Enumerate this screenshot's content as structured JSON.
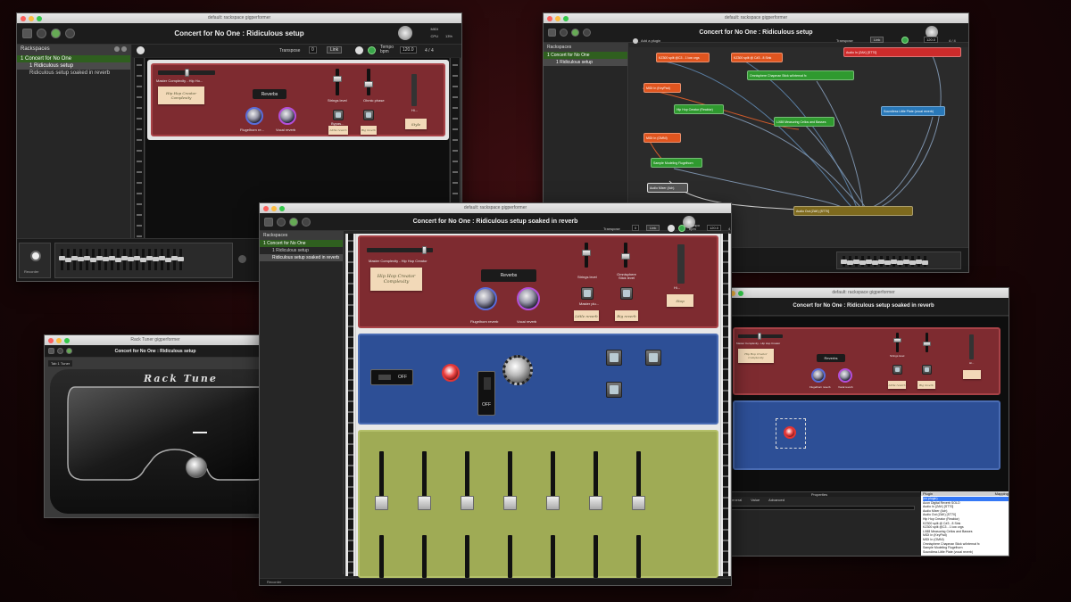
{
  "app_name": "gigperformer",
  "w1": {
    "mac_title": "default: rackspace gigperformer",
    "title": "Concert for No One : Ridiculous setup",
    "rackspaces_label": "Rackspaces",
    "items": [
      "1 Concert for No One",
      "1  Ridiculous setup",
      "Ridiculous setup soaked in reverb"
    ],
    "transpose_label": "Transpose",
    "transpose_value": "0",
    "link": "Link",
    "tempo_label": "Tempo bpm",
    "tempo": "120.0",
    "time": "4 / 4",
    "time_label": "Time",
    "cpu_label": "CPU",
    "cpu": "13%",
    "midi_label": "MIDI",
    "master": "Master Complexity - Hip Ho...",
    "note1": "Hip Hop Creator Complexity",
    "reverbs": "Reverbs",
    "k1": "Flugelhorn re...",
    "k2": "Vocal reverb",
    "strings": "Strings level",
    "ohmic": "Ohmic phase",
    "bypass": "Bypas...",
    "note_little": "Little reverb",
    "note_big": "Big reverb",
    "note_hh": "Hi...",
    "note_stp": "Style",
    "recorder": "Recorder"
  },
  "w2": {
    "mac_title": "default: rackspace gigperformer",
    "title": "Concert for No One : Ridiculous setup",
    "rackspaces_label": "Rackspaces",
    "items": [
      "1 Concert for No One",
      "1  Ridiculous setup"
    ],
    "add_plugin": "Add a plugin",
    "transpose_label": "Transpose",
    "link": "Link",
    "tempo": "120.0",
    "time": "4 / 4",
    "nodes": [
      "KZ300 split @C3 - 1 low orgs",
      "KZ300 split @ C#3 - 8 Sink",
      "Audio In (ZAK) [ST70]",
      "Omnisphere Chapman Stick w/Internal fx",
      "MIDI In (KeyPad)",
      "Hip Hop Creator (Reaktor)",
      "LX88 Measuring Cellos and Basses",
      "Soundless Little Plate (vocal reverb)",
      "MIDI In (OMNI)",
      "Sample Modeling Flugelhorn",
      "Audio Mixer (4ch)",
      "Audio Out (ZAK) [ST70]"
    ],
    "colors": {
      "orange": "#e0551f",
      "green": "#2f9a2f",
      "red": "#cc2b2b",
      "blue": "#2978b8",
      "olive": "#7e6a1e"
    }
  },
  "w3": {
    "mac_title": "Rack Tuner gigperformer",
    "title": "Concert for No One : Ridiculous setup",
    "tab": "Tab 1 Tuner",
    "logo": "Rack Tune"
  },
  "w4": {
    "mac_title": "default: rackspace gigperformer",
    "title": "Concert for No One : Ridiculous setup soaked in reverb",
    "rackspaces_label": "Rackspaces",
    "items": [
      "1 Concert for No One",
      "1  Ridiculous setup",
      "Ridiculous setup soaked in reverb"
    ],
    "transpose_label": "Transpose",
    "transpose_value": "0",
    "link": "Link",
    "tempo_label": "Tempo bpm",
    "tempo": "120.0",
    "time": "4 / 4",
    "master": "Master Complexity - Hip Hop Creator",
    "note1": "Hip Hop Creator Complexity",
    "reverbs": "Reverbs",
    "k1": "Flugelhorn reverb",
    "k2": "Vocal reverb",
    "strings": "Strings level",
    "ohmic": "Omnisphere Stick level",
    "bypass": "Master plu...",
    "note_little": "Little reverb",
    "note_big": "Big reverb",
    "note_hh": "Hi...",
    "note_stp": "Stop",
    "off1": "OFF",
    "off2": "OFF",
    "recorder": "Recorder"
  },
  "w5": {
    "mac_title": "default: rackspace gigperformer",
    "title": "Concert for No One : Ridiculous setup soaked in reverb",
    "reverbs": "Reverbs",
    "note1": "Hip Hop Creator Complexity",
    "master": "Master Complexity - Hip Hop Creator",
    "k1": "Flugelhorn reverb",
    "k2": "Vocal reverb",
    "strings": "Strings level",
    "note_little": "Little reverb",
    "note_big": "Big reverb",
    "note_hh": "Hi...",
    "properties": "Properties",
    "mapping": "Mapping",
    "tabs": [
      "General",
      "Value",
      "Advanced"
    ],
    "plugin_label": "Plugin",
    "plugin_list": [
      "(no plugin)",
      "Acon Digital Reverb SOLO",
      "Audio In (ZAK) [ST70]",
      "Audio Mixer (4ch)",
      "Audio Out (ZAK) [ST70]",
      "Hip Hop Creator (Reaktor)",
      "KZ300 split @ C#3 - 8 Sink",
      "KZ300 split @C3 - 1 low orgs",
      "LX88 Measuring Cellos and Basses",
      "MIDI In (KeyPad)",
      "MIDI In (OMNI)",
      "Omnisphere Chapman Stick w/Internal fx",
      "Sample Modeling Flugelhorn",
      "Soundless Little Plate (vocal reverb)"
    ]
  }
}
